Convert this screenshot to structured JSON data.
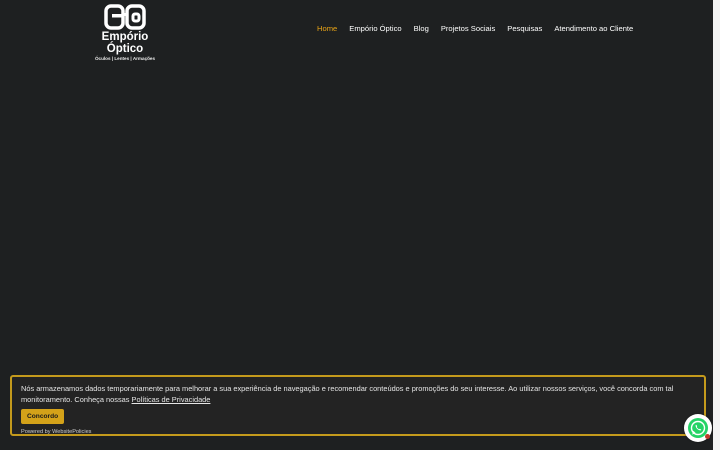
{
  "brand": {
    "name": "Empório Óptico",
    "tagline": "Óculos | Lentes | Armações",
    "logo_icon": "glasses-logo-icon"
  },
  "nav": {
    "items": [
      {
        "label": "Home",
        "active": true
      },
      {
        "label": "Empório Óptico",
        "active": false
      },
      {
        "label": "Blog",
        "active": false
      },
      {
        "label": "Projetos Sociais",
        "active": false
      },
      {
        "label": "Pesquisas",
        "active": false
      },
      {
        "label": "Atendimento ao Cliente",
        "active": false
      }
    ]
  },
  "cookie_banner": {
    "message": "Nós armazenamos dados temporariamente para melhorar a sua experiência de navegação e recomendar conteúdos e promoções do seu interesse. Ao utilizar nossos serviços, você concorda com tal monitoramento. Conheça nossas",
    "policy_link": "Políticas de Privacidade",
    "agree_label": "Concordo",
    "powered_by": "Powered by WebsitePolicies"
  },
  "widgets": {
    "chat_icon": "whatsapp-icon"
  },
  "colors": {
    "background": "#1e2021",
    "accent": "#e8a317",
    "banner_border": "#c49a1c",
    "button": "#d4a219",
    "whatsapp": "#25d366"
  }
}
